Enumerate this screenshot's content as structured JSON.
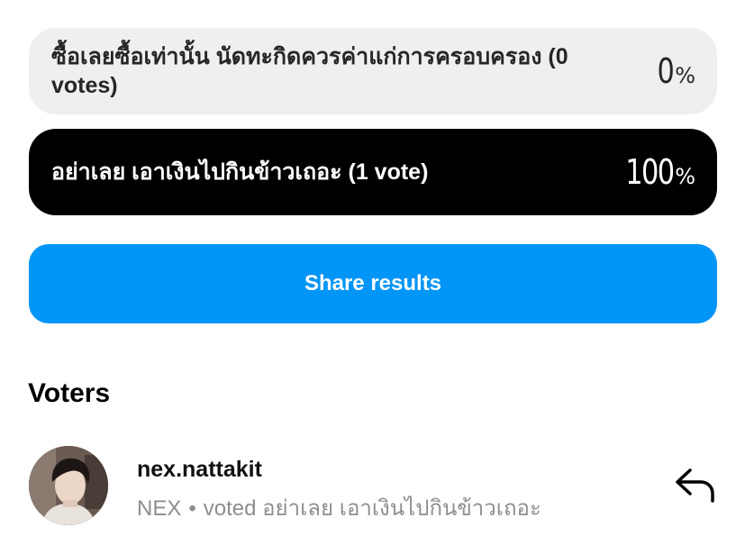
{
  "poll": {
    "options": [
      {
        "label": "ซื้อเลยซื้อเท่านั้น นัดทะกิดควรค่าแก่การครอบครอง (0 votes)",
        "percent": "0",
        "percent_sign": "%",
        "selected": false
      },
      {
        "label": "อย่าเลย เอาเงินไปกินข้าวเถอะ (1 vote)",
        "percent": "100",
        "percent_sign": "%",
        "selected": true
      }
    ],
    "share_label": "Share results"
  },
  "voters": {
    "title": "Voters",
    "items": [
      {
        "username": "nex.nattakit",
        "display_name": "NEX",
        "separator": "•",
        "vote_text": "voted อย่าเลย เอาเงินไปกินข้าวเถอะ",
        "action_icon": "reply-icon"
      }
    ]
  },
  "colors": {
    "unselected_bg": "#efefef",
    "selected_bg": "#000000",
    "share_button": "#0095f6",
    "secondary_text": "#8e8e8e"
  }
}
